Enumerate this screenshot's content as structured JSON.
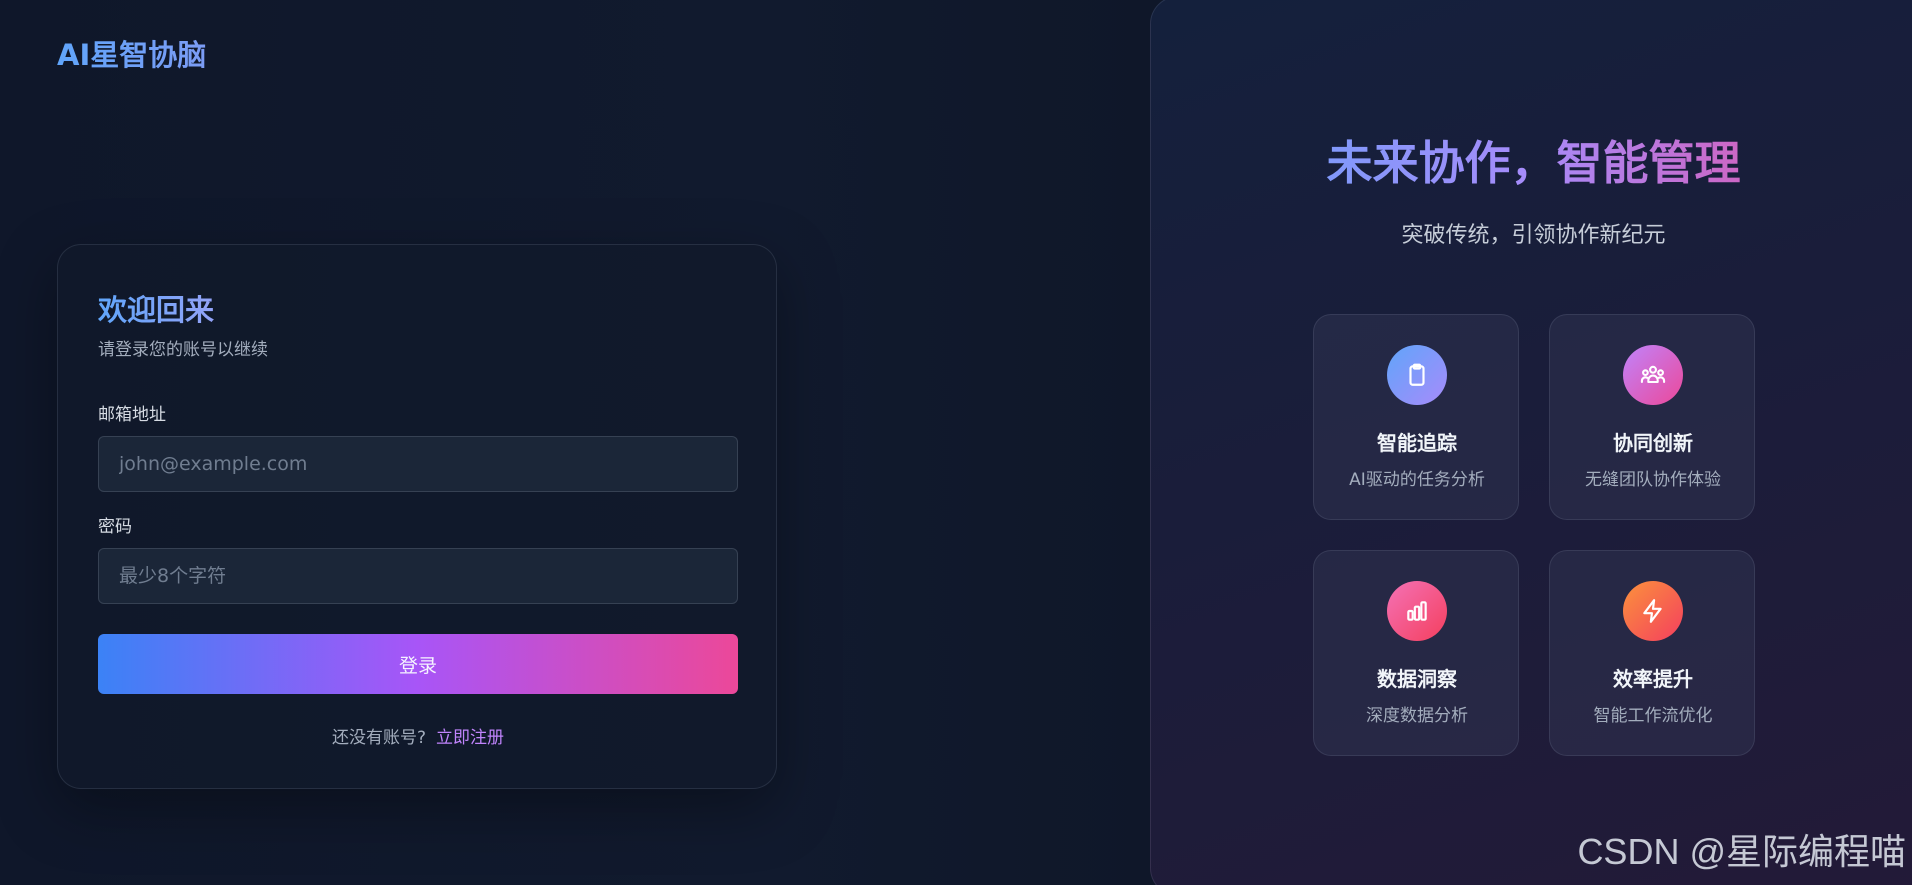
{
  "header": {
    "logo_text": "AI星智协脑"
  },
  "login": {
    "title": "欢迎回来",
    "subtitle": "请登录您的账号以继续",
    "email_label": "邮箱地址",
    "email_placeholder": "john@example.com",
    "email_value": "",
    "password_label": "密码",
    "password_placeholder": "最少8个字符",
    "password_value": "",
    "submit_label": "登录",
    "signup_prompt": "还没有账号?",
    "signup_link": "立即注册"
  },
  "hero": {
    "title": "未来协作，智能管理",
    "subtitle": "突破传统，引领协作新纪元"
  },
  "features": [
    {
      "title": "智能追踪",
      "desc": "AI驱动的任务分析",
      "icon": "clipboard-icon",
      "color_from": "#60a5fa",
      "color_to": "#a78bfa"
    },
    {
      "title": "协同创新",
      "desc": "无缝团队协作体验",
      "icon": "team-icon",
      "color_from": "#c084fc",
      "color_to": "#ec4899"
    },
    {
      "title": "数据洞察",
      "desc": "深度数据分析",
      "icon": "bar-chart-icon",
      "color_from": "#f472b6",
      "color_to": "#f43f5e"
    },
    {
      "title": "效率提升",
      "desc": "智能工作流优化",
      "icon": "lightning-icon",
      "color_from": "#fb923c",
      "color_to": "#f43f5e"
    }
  ],
  "watermark": "CSDN @星际编程喵",
  "colors": {
    "background": "#0f172a",
    "accent_blue": "#3b82f6",
    "accent_purple": "#a855f7",
    "accent_pink": "#ec4899"
  }
}
